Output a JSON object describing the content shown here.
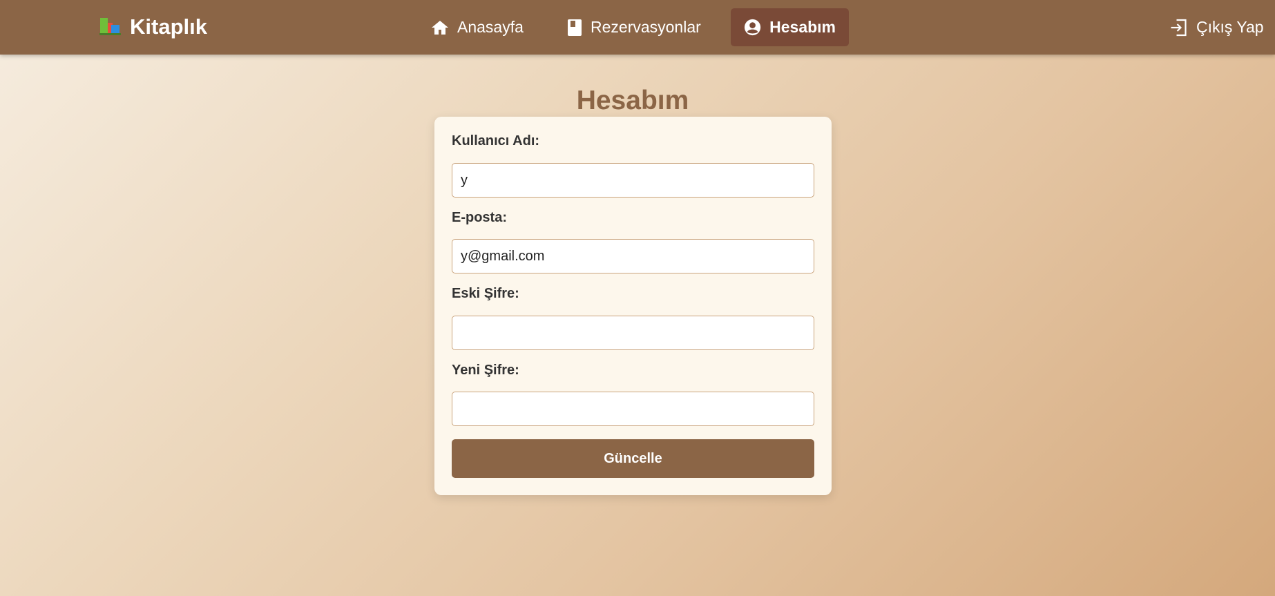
{
  "nav": {
    "brand": "Kitaplık",
    "brand_icon": "books-icon",
    "items": [
      {
        "label": "Anasayfa",
        "icon": "home-icon"
      },
      {
        "label": "Rezervasyonlar",
        "icon": "book-icon"
      },
      {
        "label": "Hesabım",
        "icon": "user-circle-icon",
        "active": true
      }
    ],
    "logout": {
      "label": "Çıkış Yap",
      "icon": "logout-icon"
    }
  },
  "page": {
    "title": "Hesabım"
  },
  "form": {
    "username": {
      "label": "Kullanıcı Adı:",
      "value": "y"
    },
    "email": {
      "label": "E-posta:",
      "value": "y@gmail.com"
    },
    "old_password": {
      "label": "Eski Şifre:",
      "value": ""
    },
    "new_password": {
      "label": "Yeni Şifre:",
      "value": ""
    },
    "submit_label": "Güncelle"
  },
  "colors": {
    "navbar": "#8b6546",
    "nav_active": "#7a4a37",
    "button": "#8b6546",
    "title": "#8b6546",
    "card": "#fdf7ec",
    "input_border": "#c9a37c"
  }
}
